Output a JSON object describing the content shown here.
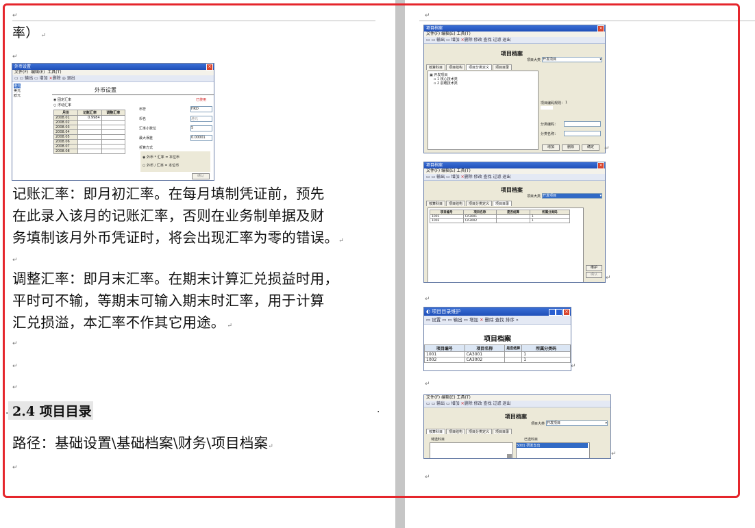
{
  "left": {
    "continued": "率）",
    "fx_window": {
      "title": "外币设置",
      "menu": [
        "文件(F)",
        "编辑(E)",
        "工具(T)"
      ],
      "toolbar": [
        "输出",
        "增加",
        "删除",
        "退出"
      ],
      "header": "外币设置",
      "currencies": [
        "港元",
        "美元",
        "欧元"
      ],
      "radio_fixed": "固定汇率",
      "radio_float": "浮动汇率",
      "in_use": "已使用",
      "grid_headers": [
        "月份",
        "记账汇率",
        "调整汇率"
      ],
      "grid_rows": [
        [
          "2008.01",
          "0.9984",
          ""
        ],
        [
          "2008.02",
          "",
          ""
        ],
        [
          "2008.03",
          "",
          ""
        ],
        [
          "2008.04",
          "",
          ""
        ],
        [
          "2008.05",
          "",
          ""
        ],
        [
          "2008.06",
          "",
          ""
        ],
        [
          "2008.07",
          "",
          ""
        ],
        [
          "2008.08",
          "",
          ""
        ]
      ],
      "fields": [
        {
          "label": "币符",
          "value": "HKD"
        },
        {
          "label": "币名",
          "value": "港元"
        },
        {
          "label": "汇率小数位",
          "value": "5"
        },
        {
          "label": "最大误差",
          "value": "0.00001"
        }
      ],
      "method_label": "折算方式",
      "method_opt1": "外币 * 汇率 = 本位币",
      "method_opt2": "外币 / 汇率 = 本位币",
      "confirm": "确认"
    },
    "para1": [
      "记账汇率：即月初汇率。在每月填制凭证前，预先",
      "在此录入该月的记账汇率，否则在业务制单据及财",
      "务填制该月外币凭证时，将会出现汇率为零的错误。"
    ],
    "para2": [
      "调整汇率：即月末汇率。在期末计算汇兑损益时用，",
      "平时可不输，等期末可输入期末时汇率，用于计算",
      "汇兑损溢，本汇率不作其它用途。"
    ],
    "heading": "2.4 项目目录",
    "path": "路径：基础设置\\基础档案\\财务\\项目档案"
  },
  "right": {
    "shot1": {
      "title": "项目档案",
      "menu": [
        "文件(F)",
        "编辑(E)",
        "工具(T)"
      ],
      "toolbar": [
        "输出",
        "增加",
        "删除",
        "修改",
        "查找",
        "过滤",
        "退出"
      ],
      "header": "项目档案",
      "category_label": "项目大类",
      "category_value": "开发项目",
      "tabs": [
        "核算科目",
        "项目结构",
        "项目分类定义",
        "项目目录"
      ],
      "tree": [
        "开发项目",
        "1 核心技术类",
        "2 前瞻技术类"
      ],
      "code_rule_label": "项目编码规则：",
      "code_rule_value": "1",
      "class_code_label": "分类编码：",
      "class_name_label": "分类名称：",
      "buttons": [
        "增加",
        "删除",
        "确定"
      ]
    },
    "shot2": {
      "title": "项目档案",
      "menu": [
        "文件(F)",
        "编辑(E)",
        "工具(T)"
      ],
      "toolbar": [
        "输出",
        "增加",
        "删除",
        "修改",
        "查找",
        "过滤",
        "退出"
      ],
      "header": "项目档案",
      "category_label": "项目大类",
      "category_value": "开发项目",
      "tabs": [
        "核算科目",
        "项目结构",
        "项目分类定义",
        "项目目录"
      ],
      "columns": [
        "项目编号",
        "项目名称",
        "是否结算",
        "所属分类码"
      ],
      "rows": [
        [
          "1001",
          "CA3001",
          "",
          "1"
        ],
        [
          "1002",
          "CA3002",
          "",
          "1"
        ]
      ],
      "buttons": [
        "维护",
        "确认"
      ]
    },
    "shot3": {
      "title": "项目目录维护",
      "toolbar": [
        "设置",
        "输出",
        "增加",
        "删除",
        "查找",
        "排序"
      ],
      "header": "项目档案",
      "columns": [
        "项目编号",
        "项目名称",
        "是否结算",
        "所属分类码"
      ],
      "rows": [
        [
          "1001",
          "CA3001",
          "",
          "1"
        ],
        [
          "1002",
          "CA3002",
          "",
          "1"
        ]
      ]
    },
    "shot4": {
      "menu": [
        "文件(F)",
        "编辑(E)",
        "工具(T)"
      ],
      "toolbar": [
        "输出",
        "增加",
        "删除",
        "修改",
        "查找",
        "过滤",
        "退出"
      ],
      "header": "项目档案",
      "category_label": "项目大类",
      "category_value": "开发项目",
      "tabs": [
        "核算科目",
        "项目结构",
        "项目分类定义",
        "项目目录"
      ],
      "left_list_label": "待选科目",
      "right_list_label": "已选科目",
      "selected_item": "5001 研发支出"
    }
  }
}
